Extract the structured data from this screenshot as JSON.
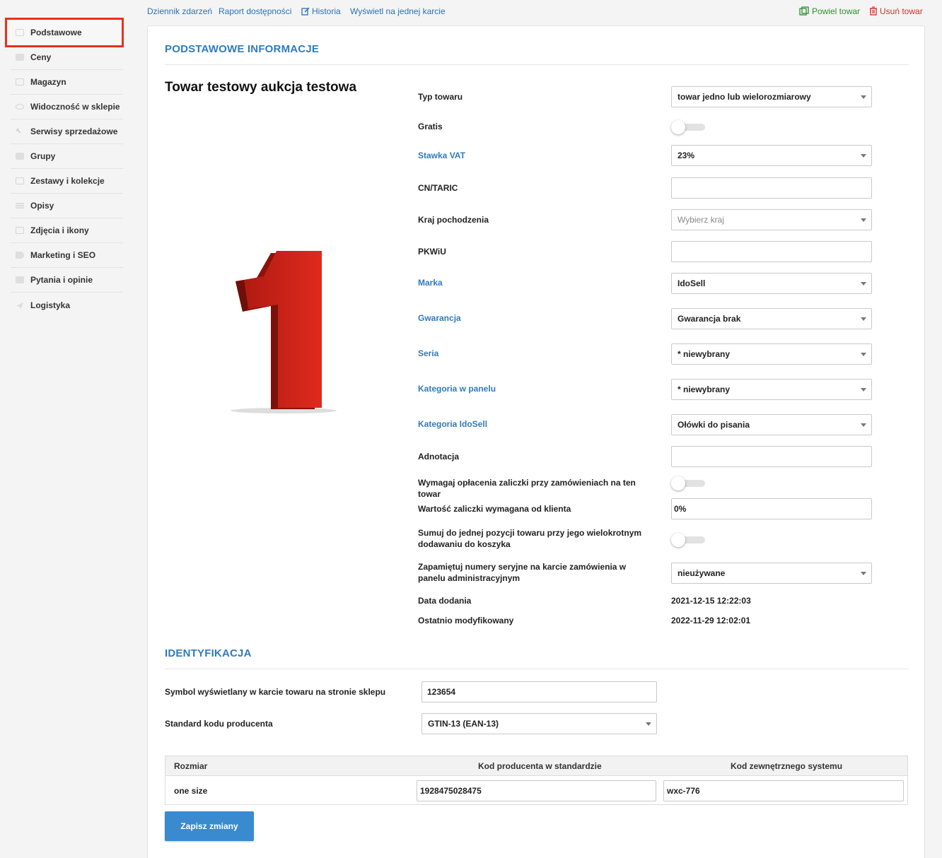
{
  "sidebar": {
    "items": [
      {
        "label": "Podstawowe",
        "icon": "cube-icon",
        "active": true
      },
      {
        "label": "Ceny",
        "icon": "price-icon"
      },
      {
        "label": "Magazyn",
        "icon": "warehouse-icon"
      },
      {
        "label": "Widoczność w sklepie",
        "icon": "eye-icon"
      },
      {
        "label": "Serwisy sprzedażowe",
        "icon": "hammer-icon"
      },
      {
        "label": "Grupy",
        "icon": "layers-icon"
      },
      {
        "label": "Zestawy i kolekcje",
        "icon": "sets-icon"
      },
      {
        "label": "Opisy",
        "icon": "text-icon"
      },
      {
        "label": "Zdjęcia i ikony",
        "icon": "camera-icon"
      },
      {
        "label": "Marketing i SEO",
        "icon": "tag-icon"
      },
      {
        "label": "Pytania i opinie",
        "icon": "chat-icon"
      },
      {
        "label": "Logistyka",
        "icon": "send-icon"
      }
    ]
  },
  "topbar": {
    "event_log": "Dziennik zdarzeń",
    "availability_report": "Raport dostępności",
    "history": "Historia",
    "single_card": "Wyświetl na jednej karcie",
    "duplicate": "Powiel towar",
    "delete": "Usuń towar"
  },
  "colors": {
    "accent": "#2f7bbf",
    "highlight": "#e8311f",
    "duplicate": "#2f8f2f",
    "delete": "#d1302a",
    "button": "#3a8ad0"
  },
  "basic": {
    "section_title": "PODSTAWOWE INFORMACJE",
    "product_title": "Towar testowy aukcja testowa",
    "image_alt": "1",
    "fields": {
      "product_type": {
        "label": "Typ towaru",
        "value": "towar jedno lub wielorozmiarowy"
      },
      "gratis": {
        "label": "Gratis",
        "checked": false
      },
      "vat": {
        "label": "Stawka VAT",
        "value": "23%"
      },
      "cn_taric": {
        "label": "CN/TARIC",
        "value": ""
      },
      "country": {
        "label": "Kraj pochodzenia",
        "placeholder": "Wybierz kraj"
      },
      "pkwiu": {
        "label": "PKWiU",
        "value": ""
      },
      "brand": {
        "label": "Marka",
        "value": "IdoSell"
      },
      "warranty": {
        "label": "Gwarancja",
        "value": "Gwarancja brak"
      },
      "series": {
        "label": "Seria",
        "value": "* niewybrany"
      },
      "panel_category": {
        "label": "Kategoria w panelu",
        "value": "* niewybrany"
      },
      "idosell_category": {
        "label": "Kategoria IdoSell",
        "value": "Ołówki do pisania"
      },
      "annotation": {
        "label": "Adnotacja",
        "value": ""
      },
      "require_advance": {
        "label": "Wymagaj opłacenia zaliczki przy zamówieniach na ten towar",
        "checked": false
      },
      "advance_value": {
        "label": "Wartość zaliczki wymagana od klienta",
        "value": "0%"
      },
      "sum_position": {
        "label": "Sumuj do jednej pozycji towaru przy jego wielokrotnym dodawaniu do koszyka",
        "checked": false
      },
      "serial_numbers": {
        "label": "Zapamiętuj numery seryjne na karcie zamówienia w panelu administracyjnym",
        "value": "nieużywane"
      },
      "date_added": {
        "label": "Data dodania",
        "value": "2021-12-15 12:22:03"
      },
      "last_modified": {
        "label": "Ostatnio modyfikowany",
        "value": "2022-11-29 12:02:01"
      }
    }
  },
  "identification": {
    "section_title": "IDENTYFIKACJA",
    "symbol": {
      "label": "Symbol wyświetlany w karcie towaru na stronie sklepu",
      "value": "123654"
    },
    "code_standard": {
      "label": "Standard kodu producenta",
      "value": "GTIN-13 (EAN-13)"
    },
    "table": {
      "headers": [
        "Rozmiar",
        "Kod producenta w standardzie",
        "Kod zewnętrznego systemu"
      ],
      "rows": [
        {
          "size": "one size",
          "producer_code": "1928475028475",
          "external_code": "wxc-776"
        }
      ]
    }
  },
  "save_label": "Zapisz zmiany"
}
